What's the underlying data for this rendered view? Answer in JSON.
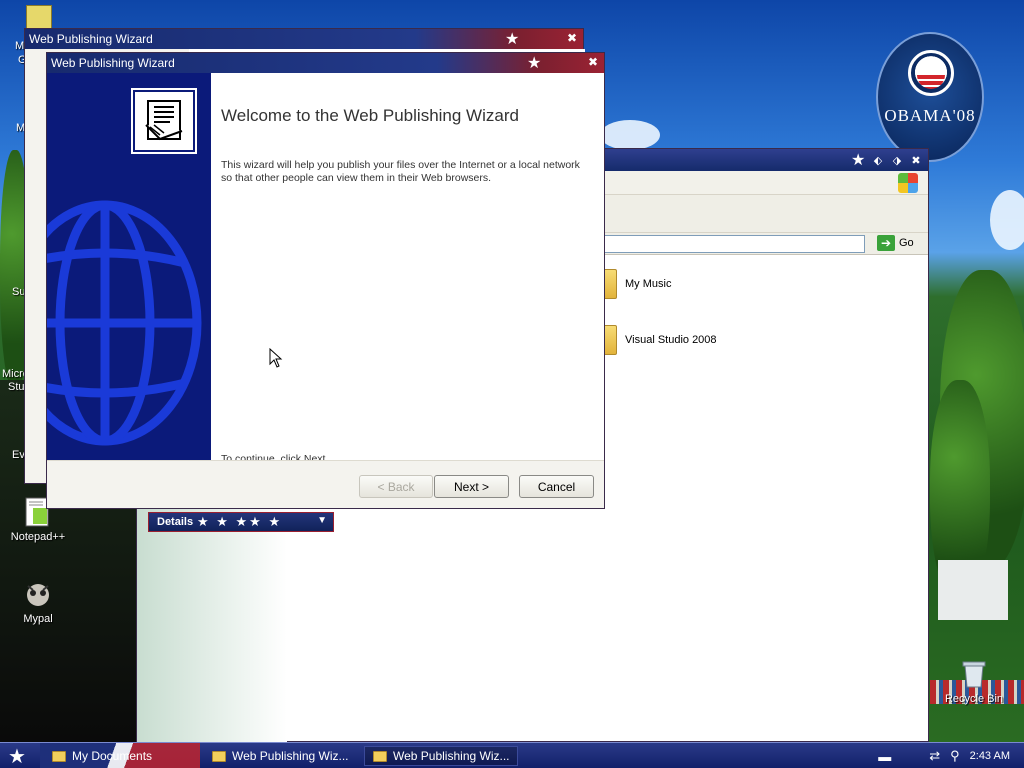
{
  "desktop": {
    "icons": [
      {
        "label": "Notepad++",
        "icon": "notepadpp-icon"
      },
      {
        "label": "Mypal",
        "icon": "mypal-icon"
      },
      {
        "label": "Recycle Bin",
        "icon": "recycle-bin-icon"
      }
    ],
    "partial_labels": [
      "M",
      "G",
      "M",
      "Su",
      "Micro",
      "Stu",
      "Ev"
    ]
  },
  "wallpaper": {
    "badge_text": "OBAMA'08"
  },
  "explorer": {
    "go_label": "Go",
    "items": [
      {
        "label": "My Music",
        "icon": "folder-icon"
      },
      {
        "label": "Visual Studio 2008",
        "icon": "folder-icon"
      }
    ],
    "details_label": "Details"
  },
  "wizard_back": {
    "title": "Web Publishing Wizard"
  },
  "wizard": {
    "title": "Web Publishing Wizard",
    "heading": "Welcome to the Web Publishing Wizard",
    "intro": "This wizard will help you publish your files over the Internet or a local network so that other people can view them in their Web browsers.",
    "continue_text": "To continue, click Next.",
    "buttons": {
      "back": "< Back",
      "next": "Next >",
      "cancel": "Cancel"
    }
  },
  "taskbar": {
    "items": [
      {
        "label": "My Documents",
        "icon": "folder-icon"
      },
      {
        "label": "Web Publishing Wiz...",
        "icon": "folder-icon"
      },
      {
        "label": "Web Publishing Wiz...",
        "icon": "folder-icon"
      }
    ],
    "clock": "2:43 AM"
  },
  "colors": {
    "wizard_sidebar": "#0b1a7a",
    "title_bar": "#172a6e",
    "accent_red": "#9b2233"
  }
}
